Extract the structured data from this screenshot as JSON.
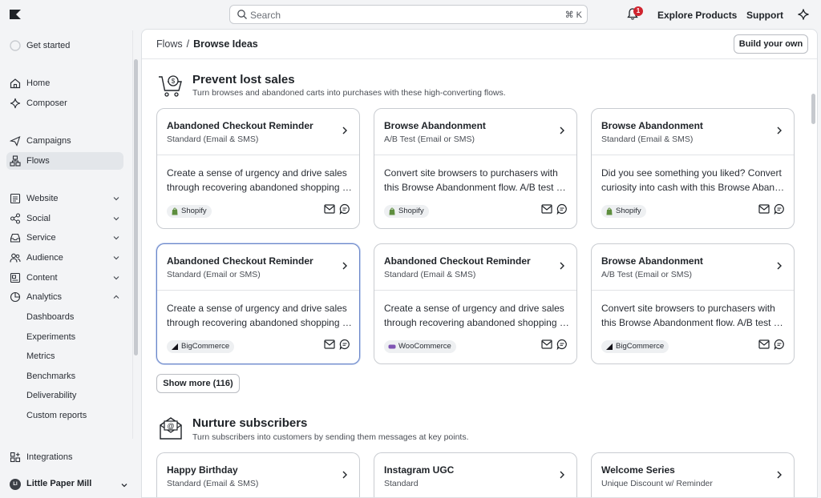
{
  "topbar": {
    "search_placeholder": "Search",
    "search_shortcut": "⌘ K",
    "notification_count": "1",
    "explore_label": "Explore Products",
    "support_label": "Support"
  },
  "sidebar": {
    "get_started": "Get started",
    "home": "Home",
    "composer": "Composer",
    "campaigns": "Campaigns",
    "flows": "Flows",
    "website": "Website",
    "social": "Social",
    "service": "Service",
    "audience": "Audience",
    "content": "Content",
    "analytics": "Analytics",
    "analytics_items": [
      "Dashboards",
      "Experiments",
      "Metrics",
      "Benchmarks",
      "Deliverability",
      "Custom reports"
    ],
    "integrations": "Integrations",
    "account_initials": "LI",
    "account_name": "Little Paper Mill"
  },
  "header": {
    "breadcrumb_parent": "Flows",
    "breadcrumb_separator": "/",
    "breadcrumb_current": "Browse Ideas",
    "build_button": "Build your own"
  },
  "sections": [
    {
      "title": "Prevent lost sales",
      "subtitle": "Turn browses and abandoned carts into purchases with these high-converting flows.",
      "icon": "cart-dollar-icon",
      "show_more": "Show more (116)",
      "cards": [
        {
          "title": "Abandoned Checkout Reminder",
          "subtitle": "Standard (Email & SMS)",
          "desc1": "Create a sense of urgency and drive sales",
          "desc2": "through recovering abandoned shopping carts",
          "platform": "Shopify"
        },
        {
          "title": "Browse Abandonment",
          "subtitle": "A/B Test (Email or SMS)",
          "desc1": "Convert site browsers to purchasers with",
          "desc2": "this Browse Abandonment flow. A/B test different",
          "platform": "Shopify"
        },
        {
          "title": "Browse Abandonment",
          "subtitle": "Standard (Email & SMS)",
          "desc1": "Did you see something you liked? Convert",
          "desc2": "curiosity into cash with this Browse Abandonment",
          "platform": "Shopify"
        },
        {
          "title": "Abandoned Checkout Reminder",
          "subtitle": "Standard (Email or SMS)",
          "desc1": "Create a sense of urgency and drive sales",
          "desc2": "through recovering abandoned shopping carts",
          "platform": "BigCommerce"
        },
        {
          "title": "Abandoned Checkout Reminder",
          "subtitle": "Standard (Email & SMS)",
          "desc1": "Create a sense of urgency and drive sales",
          "desc2": "through recovering abandoned shopping carts",
          "platform": "WooCommerce"
        },
        {
          "title": "Browse Abandonment",
          "subtitle": "A/B Test (Email or SMS)",
          "desc1": "Convert site browsers to purchasers with",
          "desc2": "this Browse Abandonment flow. A/B test different",
          "platform": "BigCommerce"
        }
      ]
    },
    {
      "title": "Nurture subscribers",
      "subtitle": "Turn subscribers into customers by sending them messages at key points.",
      "icon": "email-envelope-icon",
      "cards": [
        {
          "title": "Happy Birthday",
          "subtitle": "Standard (Email & SMS)"
        },
        {
          "title": "Instagram UGC",
          "subtitle": "Standard"
        },
        {
          "title": "Welcome Series",
          "subtitle": "Unique Discount w/ Reminder"
        }
      ]
    }
  ],
  "colors": {
    "shopify": "#5e8e3e",
    "woocommerce": "#7f54b3",
    "bigcommerce": "#121118",
    "notification": "#d0242f",
    "selected_border": "#6a86c9"
  }
}
